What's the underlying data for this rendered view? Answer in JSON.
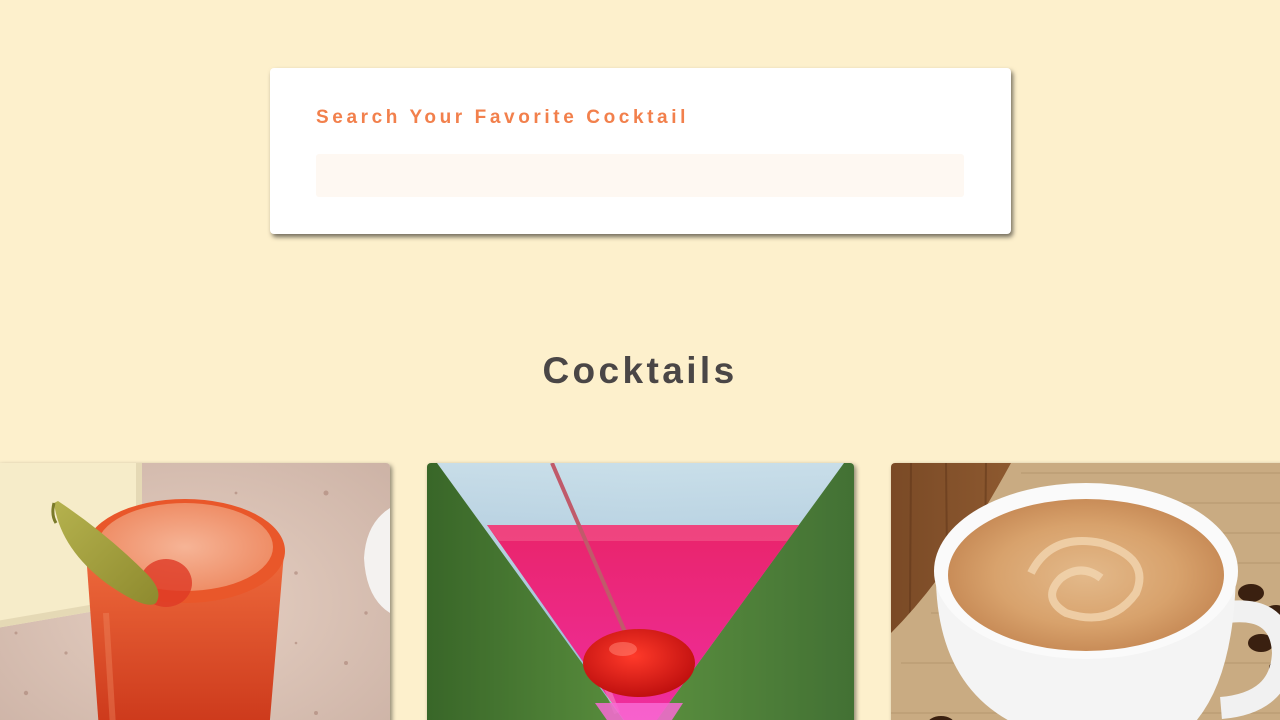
{
  "search": {
    "label": "Search Your Favorite Cocktail",
    "value": ""
  },
  "section": {
    "title": "Cocktails"
  },
  "cocktails": [
    {
      "image": "red-cocktail-with-okra-garnish"
    },
    {
      "image": "pink-martini-with-cherry"
    },
    {
      "image": "cappuccino-cup-on-burlap"
    }
  ],
  "colors": {
    "background": "#fdf0cc",
    "accent": "#f2804c",
    "title": "#4a4646",
    "card": "#ffffff",
    "input": "#fef8f2"
  }
}
